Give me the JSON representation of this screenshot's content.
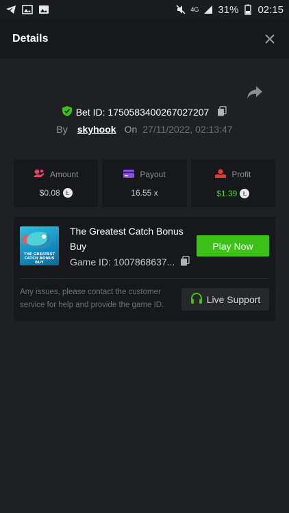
{
  "status_bar": {
    "network": "4G",
    "battery": "31%",
    "time": "02:15"
  },
  "header": {
    "title": "Details"
  },
  "bet": {
    "id_label": "Bet ID: 1750583400267027207",
    "by_label": "By",
    "user": "skyhook",
    "on_label": "On",
    "datetime": "27/11/2022, 02:13:47"
  },
  "stats": {
    "amount": {
      "label": "Amount",
      "value": "$0.08"
    },
    "payout": {
      "label": "Payout",
      "value": "16.55 x"
    },
    "profit": {
      "label": "Profit",
      "value": "$1.39"
    }
  },
  "game": {
    "name": "The Greatest Catch Bonus Buy",
    "id_label": "Game ID: 1007868637...",
    "thumb_caption": "THE GREATEST CATCH BONUS BUY",
    "play_label": "Play Now"
  },
  "support": {
    "text": "Any issues, please contact the customer service for help and provide the game ID.",
    "button_label": "Live Support"
  },
  "colors": {
    "accent_green": "#3bc117",
    "profit_green": "#4cd137",
    "amount_icon": "#e8416b",
    "payout_icon": "#8a4de8",
    "profit_icon": "#e53935"
  }
}
